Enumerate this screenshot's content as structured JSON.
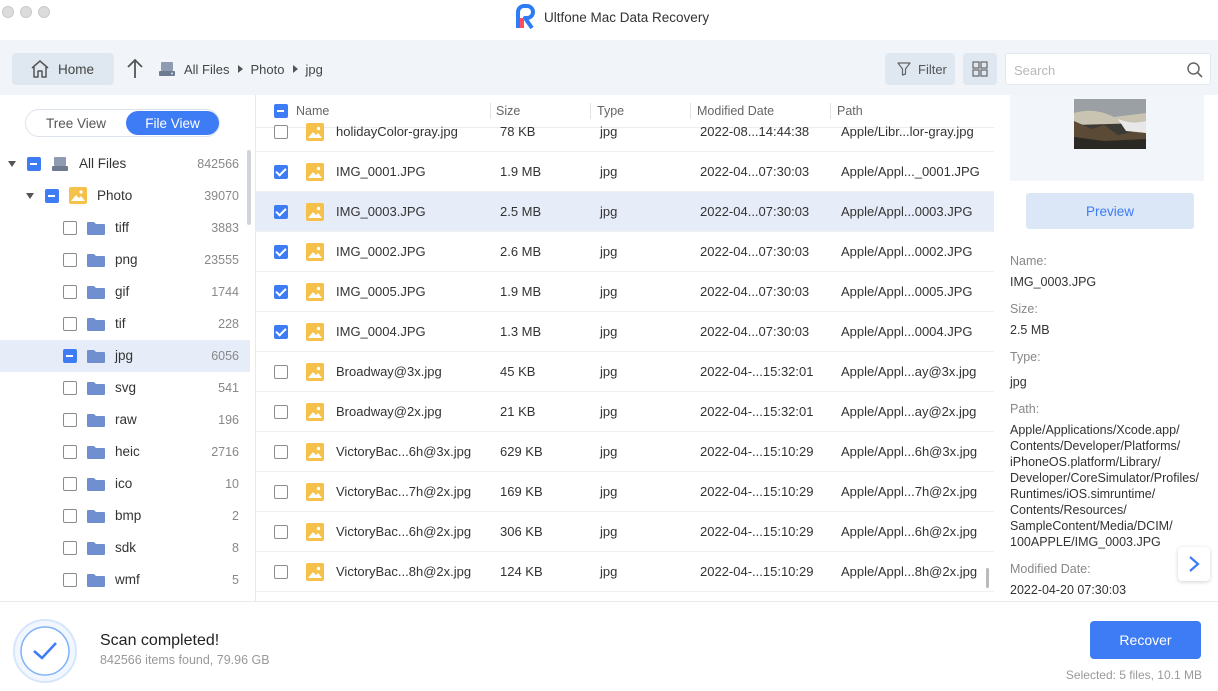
{
  "app": {
    "title": "Ultfone Mac Data Recovery"
  },
  "toolbar": {
    "home_label": "Home",
    "breadcrumb": [
      "All Files",
      "Photo",
      "jpg"
    ],
    "filter_label": "Filter",
    "search_placeholder": "Search"
  },
  "view_toggle": {
    "tree_view": "Tree View",
    "file_view": "File View"
  },
  "tree": {
    "root": {
      "label": "All Files",
      "count": "842566"
    },
    "photo": {
      "label": "Photo",
      "count": "39070"
    },
    "folders": [
      {
        "label": "tiff",
        "count": "3883"
      },
      {
        "label": "png",
        "count": "23555"
      },
      {
        "label": "gif",
        "count": "1744"
      },
      {
        "label": "tif",
        "count": "228"
      },
      {
        "label": "jpg",
        "count": "6056"
      },
      {
        "label": "svg",
        "count": "541"
      },
      {
        "label": "raw",
        "count": "196"
      },
      {
        "label": "heic",
        "count": "2716"
      },
      {
        "label": "ico",
        "count": "10"
      },
      {
        "label": "bmp",
        "count": "2"
      },
      {
        "label": "sdk",
        "count": "8"
      },
      {
        "label": "wmf",
        "count": "5"
      }
    ]
  },
  "list": {
    "headers": {
      "name": "Name",
      "size": "Size",
      "type": "Type",
      "modified": "Modified Date",
      "path": "Path"
    },
    "rows": [
      {
        "name": "holidayColor-gray.jpg",
        "size": "78 KB",
        "type": "jpg",
        "modified": "2022-08...14:44:38",
        "path": "Apple/Libr...lor-gray.jpg",
        "checked": false
      },
      {
        "name": "IMG_0001.JPG",
        "size": "1.9 MB",
        "type": "jpg",
        "modified": "2022-04...07:30:03",
        "path": "Apple/Appl..._0001.JPG",
        "checked": true
      },
      {
        "name": "IMG_0003.JPG",
        "size": "2.5 MB",
        "type": "jpg",
        "modified": "2022-04...07:30:03",
        "path": "Apple/Appl...0003.JPG",
        "checked": true
      },
      {
        "name": "IMG_0002.JPG",
        "size": "2.6 MB",
        "type": "jpg",
        "modified": "2022-04...07:30:03",
        "path": "Apple/Appl...0002.JPG",
        "checked": true
      },
      {
        "name": "IMG_0005.JPG",
        "size": "1.9 MB",
        "type": "jpg",
        "modified": "2022-04...07:30:03",
        "path": "Apple/Appl...0005.JPG",
        "checked": true
      },
      {
        "name": "IMG_0004.JPG",
        "size": "1.3 MB",
        "type": "jpg",
        "modified": "2022-04...07:30:03",
        "path": "Apple/Appl...0004.JPG",
        "checked": true
      },
      {
        "name": "Broadway@3x.jpg",
        "size": "45 KB",
        "type": "jpg",
        "modified": "2022-04-...15:32:01",
        "path": "Apple/Appl...ay@3x.jpg",
        "checked": false
      },
      {
        "name": "Broadway@2x.jpg",
        "size": "21 KB",
        "type": "jpg",
        "modified": "2022-04-...15:32:01",
        "path": "Apple/Appl...ay@2x.jpg",
        "checked": false
      },
      {
        "name": "VictoryBac...6h@3x.jpg",
        "size": "629 KB",
        "type": "jpg",
        "modified": "2022-04-...15:10:29",
        "path": "Apple/Appl...6h@3x.jpg",
        "checked": false
      },
      {
        "name": "VictoryBac...7h@2x.jpg",
        "size": "169 KB",
        "type": "jpg",
        "modified": "2022-04-...15:10:29",
        "path": "Apple/Appl...7h@2x.jpg",
        "checked": false
      },
      {
        "name": "VictoryBac...6h@2x.jpg",
        "size": "306 KB",
        "type": "jpg",
        "modified": "2022-04-...15:10:29",
        "path": "Apple/Appl...6h@2x.jpg",
        "checked": false
      },
      {
        "name": "VictoryBac...8h@2x.jpg",
        "size": "124 KB",
        "type": "jpg",
        "modified": "2022-04-...15:10:29",
        "path": "Apple/Appl...8h@2x.jpg",
        "checked": false
      }
    ]
  },
  "details": {
    "preview_label": "Preview",
    "name_label": "Name:",
    "name_value": "IMG_0003.JPG",
    "size_label": "Size:",
    "size_value": "2.5 MB",
    "type_label": "Type:",
    "type_value": "jpg",
    "path_label": "Path:",
    "path_lines": [
      "Apple/Applications/Xcode.app/",
      "Contents/Developer/Platforms/",
      "iPhoneOS.platform/Library/",
      "Developer/CoreSimulator/Profiles/",
      "Runtimes/iOS.simruntime/",
      "Contents/Resources/",
      "SampleContent/Media/DCIM/",
      "100APPLE/IMG_0003.JPG"
    ],
    "modified_label": "Modified Date:",
    "modified_value": "2022-04-20 07:30:03"
  },
  "status": {
    "title": "Scan completed!",
    "subtitle": "842566 items found, 79.96 GB",
    "recover_label": "Recover",
    "selected_info": "Selected: 5 files, 10.1 MB"
  },
  "colors": {
    "accent": "#3e7cf5",
    "selected_row": "#e6ecf8",
    "toolbar_bg": "#f1f5fa"
  }
}
